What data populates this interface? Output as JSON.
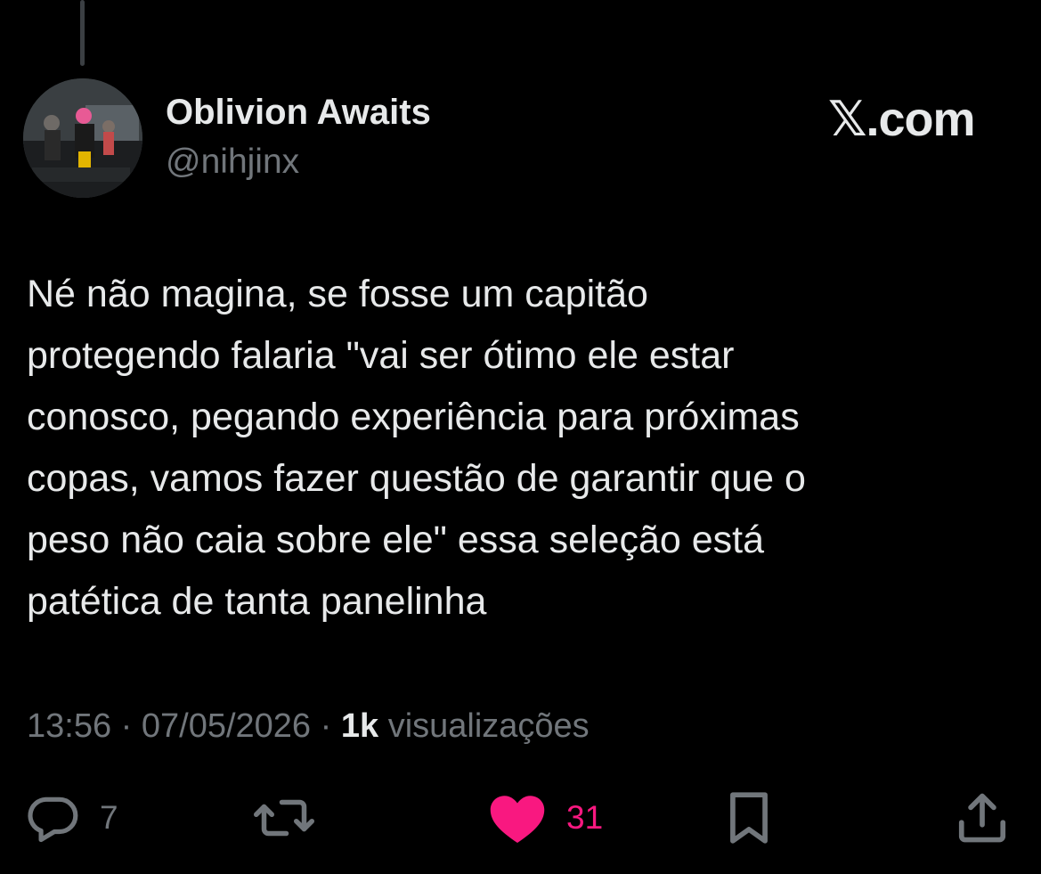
{
  "post": {
    "author_name": "Oblivion Awaits",
    "author_handle": "@nihjinx",
    "brand": "𝕏.com",
    "text": "Né não magina, se fosse um capitão\nprotegendo falaria \"vai ser ótimo ele estar\nconosco, pegando experiência para próximas\ncopas, vamos fazer questão de garantir que o\npeso não caia sobre ele\" essa seleção está\npatética de tanta panelinha",
    "time": "13:56",
    "date": "07/05/2026",
    "separator": "·",
    "views_count": "1k",
    "views_label": "visualizações"
  },
  "actions": {
    "reply_count": "7",
    "like_count": "31"
  },
  "colors": {
    "background": "#000000",
    "text_primary": "#e7e9ea",
    "text_secondary": "#71767b",
    "like_active": "#f91880"
  },
  "icons": [
    "avatar",
    "reply-icon",
    "repost-icon",
    "like-icon",
    "bookmark-icon",
    "share-icon"
  ]
}
